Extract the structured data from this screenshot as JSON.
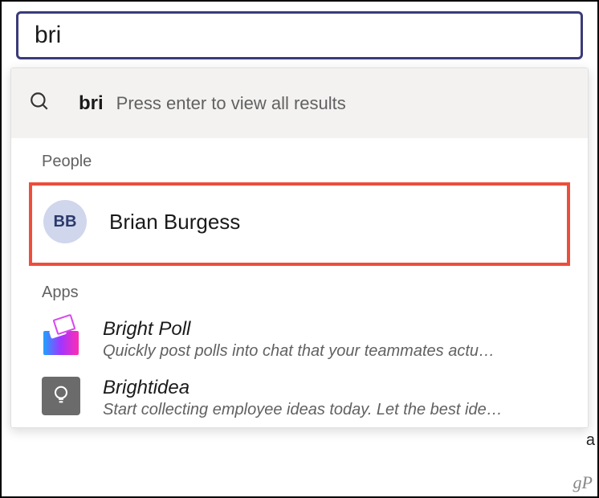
{
  "search": {
    "value": "bri"
  },
  "allResults": {
    "query": "bri",
    "hint": "Press enter to view all results"
  },
  "sections": {
    "people": {
      "label": "People",
      "items": [
        {
          "initials": "BB",
          "name": "Brian Burgess"
        }
      ]
    },
    "apps": {
      "label": "Apps",
      "items": [
        {
          "name": "Bright Poll",
          "desc": "Quickly post polls into chat that your teammates actu…"
        },
        {
          "name": "Brightidea",
          "desc": "Start collecting employee ideas today. Let the best ide…"
        }
      ]
    }
  },
  "watermark": "gP",
  "stray": "a"
}
